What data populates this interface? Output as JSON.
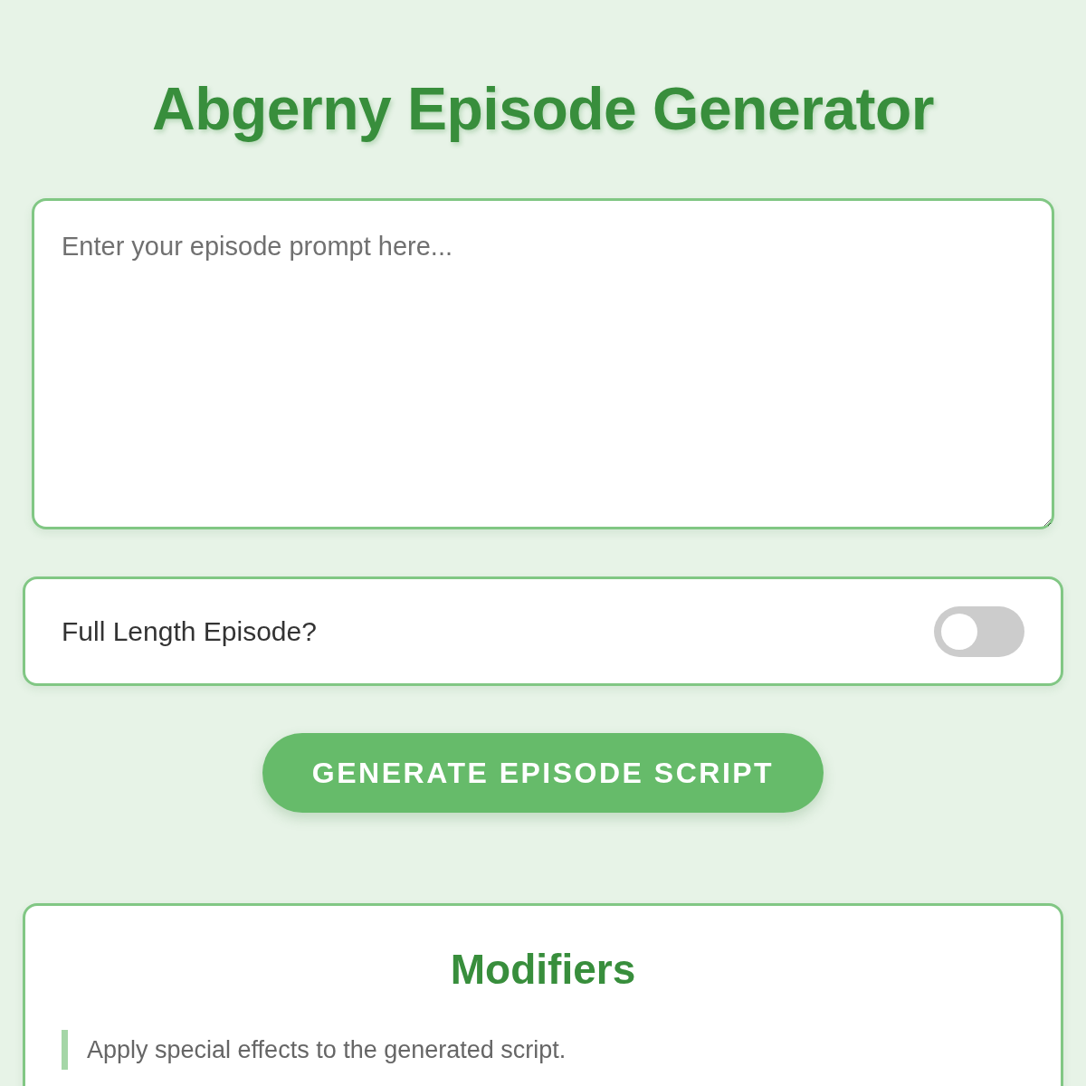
{
  "title": "Abgerny Episode Generator",
  "prompt": {
    "placeholder": "Enter your episode prompt here..."
  },
  "full_length": {
    "label": "Full Length Episode?",
    "on": false
  },
  "generate_button": {
    "label": "GENERATE EPISODE SCRIPT"
  },
  "modifiers": {
    "title": "Modifiers",
    "description": "Apply special effects to the generated script."
  }
}
